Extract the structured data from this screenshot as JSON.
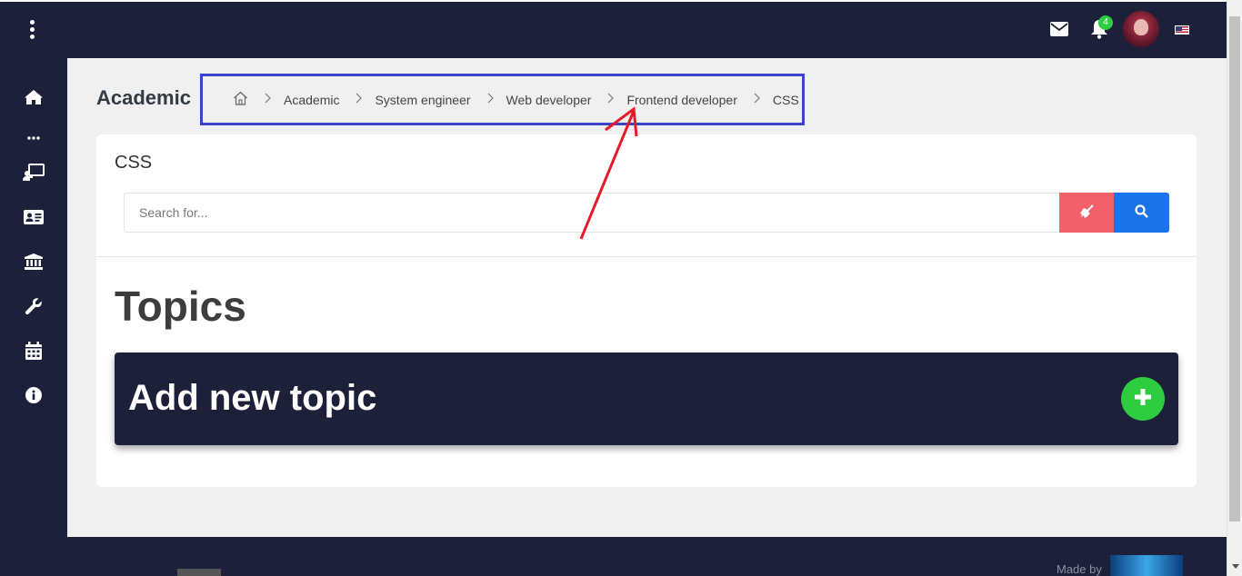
{
  "topbar": {
    "menu_icon": "vertical-dots-icon",
    "notifications_count": "4",
    "icons": [
      "envelope-icon",
      "bell-icon",
      "avatar",
      "us-flag-icon"
    ]
  },
  "sidebar": {
    "items": [
      {
        "icon": "home-icon"
      },
      {
        "icon": "more-dots-icon"
      },
      {
        "icon": "teacher-board-icon"
      },
      {
        "icon": "id-card-icon"
      },
      {
        "icon": "bank-icon"
      },
      {
        "icon": "wrench-icon"
      },
      {
        "icon": "calendar-icon"
      },
      {
        "icon": "info-icon"
      }
    ]
  },
  "page": {
    "title": "Academic"
  },
  "breadcrumb": {
    "home_icon": "home-outline-icon",
    "items": [
      "Academic",
      "System engineer",
      "Web developer",
      "Frontend developer",
      "CSS"
    ]
  },
  "card": {
    "title": "CSS",
    "search_placeholder": "Search for...",
    "clear_icon": "broom-icon",
    "search_icon": "search-icon"
  },
  "topics": {
    "heading": "Topics",
    "add_label": "Add new topic",
    "add_icon": "plus-icon"
  },
  "footer": {
    "made_by": "Made by"
  },
  "colors": {
    "navy": "#1c2039",
    "breadcrumb_border": "#3b43c8",
    "annotation_arrow": "#e8192c",
    "clear_button": "#f0616a",
    "search_button": "#1a73e8",
    "add_button": "#2ecc40"
  }
}
